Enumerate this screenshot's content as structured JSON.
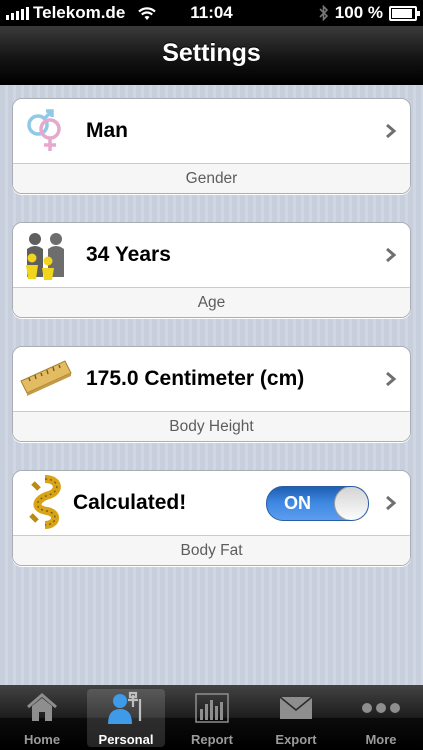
{
  "status_bar": {
    "carrier": "Telekom.de",
    "time": "11:04",
    "battery": "100 %"
  },
  "nav": {
    "title": "Settings"
  },
  "settings": [
    {
      "icon": "gender-symbol-icon",
      "value": "Man",
      "label": "Gender"
    },
    {
      "icon": "family-icon",
      "value": "34 Years",
      "label": "Age"
    },
    {
      "icon": "ruler-icon",
      "value": "175.0 Centimeter (cm)",
      "label": "Body Height"
    },
    {
      "icon": "measuring-tape-icon",
      "value": "Calculated!",
      "label": "Body Fat",
      "toggle": "ON"
    }
  ],
  "tabs": [
    {
      "label": "Home",
      "icon": "house-icon"
    },
    {
      "label": "Personal",
      "icon": "person-tools-icon",
      "active": true
    },
    {
      "label": "Report",
      "icon": "bar-chart-icon"
    },
    {
      "label": "Export",
      "icon": "envelope-icon"
    },
    {
      "label": "More",
      "icon": "ellipsis-icon"
    }
  ],
  "colors": {
    "toggle_on": "#3d86e1",
    "nav_bar": "#141414",
    "background": "#cdd3df"
  }
}
